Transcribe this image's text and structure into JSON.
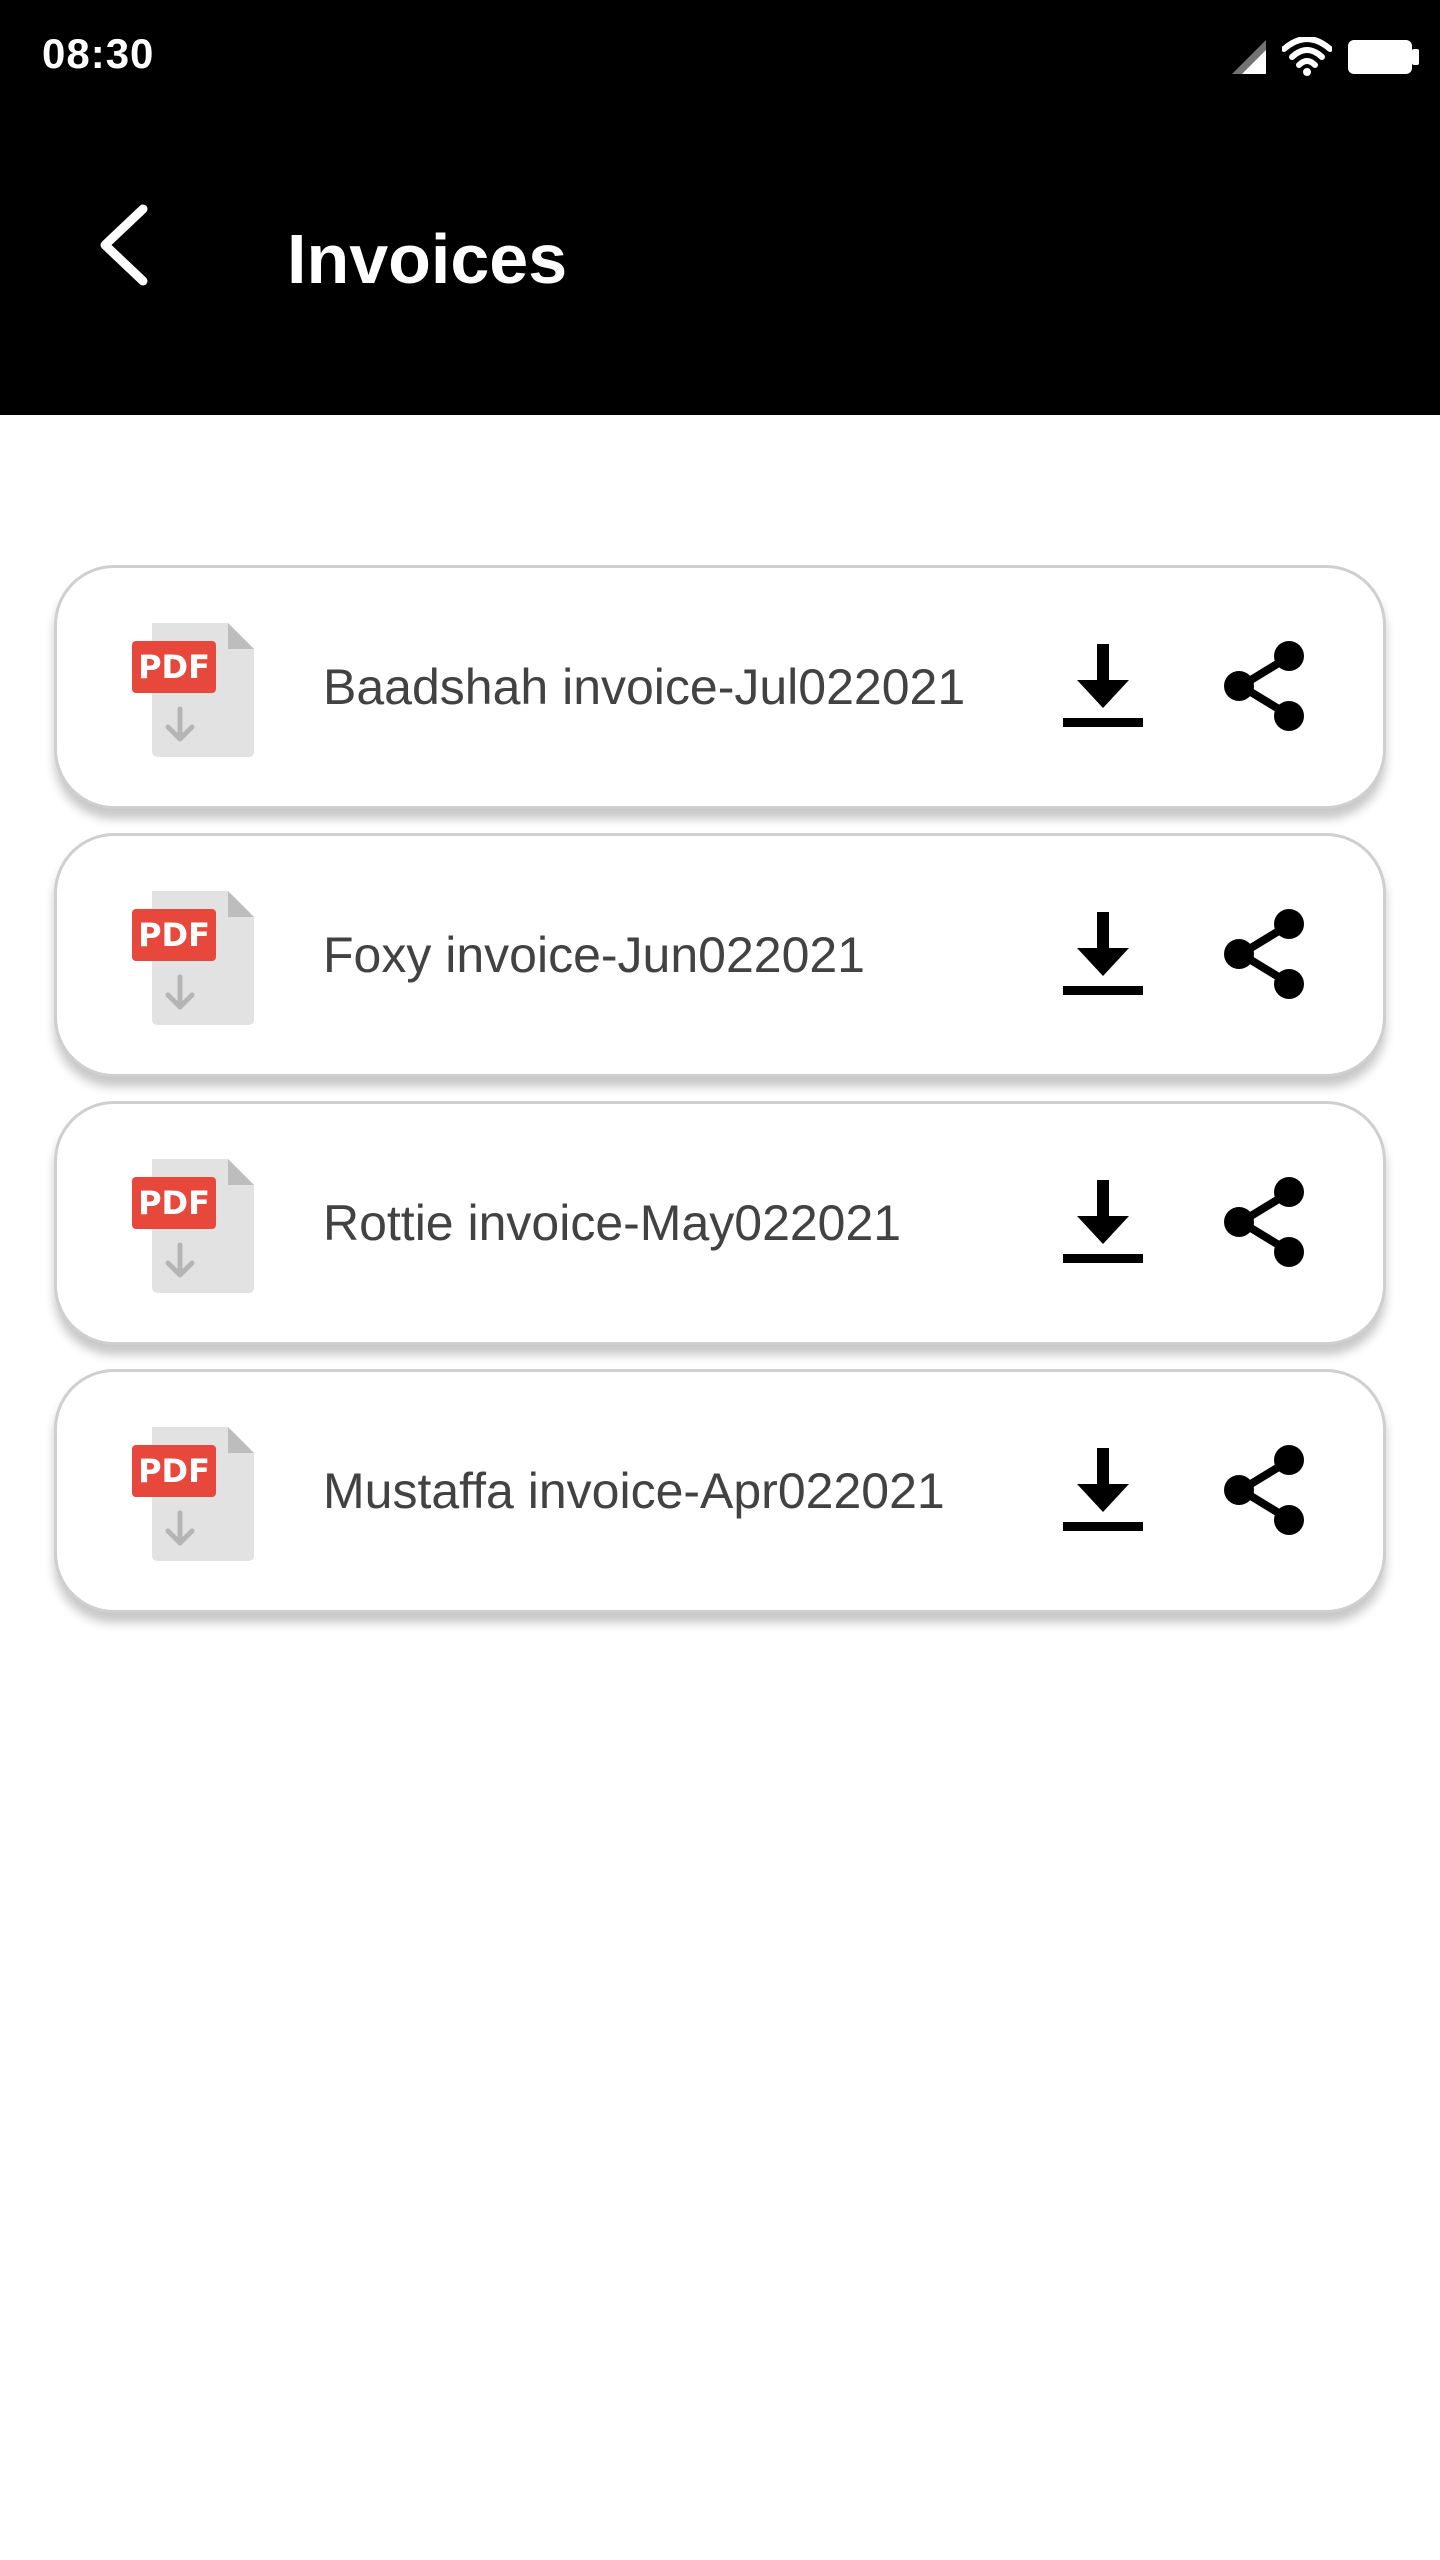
{
  "status_bar": {
    "time": "08:30",
    "icons": [
      "signal-icon",
      "wifi-icon",
      "battery-icon"
    ]
  },
  "app_bar": {
    "title": "Invoices",
    "back_icon": "back-arrow-icon"
  },
  "invoices": [
    {
      "name": "Baadshah invoice-Jul022021",
      "file_badge": "PDF"
    },
    {
      "name": "Foxy invoice-Jun022021",
      "file_badge": "PDF"
    },
    {
      "name": "Rottie invoice-May022021",
      "file_badge": "PDF"
    },
    {
      "name": "Mustaffa invoice-Apr022021",
      "file_badge": "PDF"
    }
  ],
  "colors": {
    "header_bg": "#000000",
    "pdf_red": "#e8473c",
    "text": "#424242",
    "card_border": "#cfcfcf"
  }
}
